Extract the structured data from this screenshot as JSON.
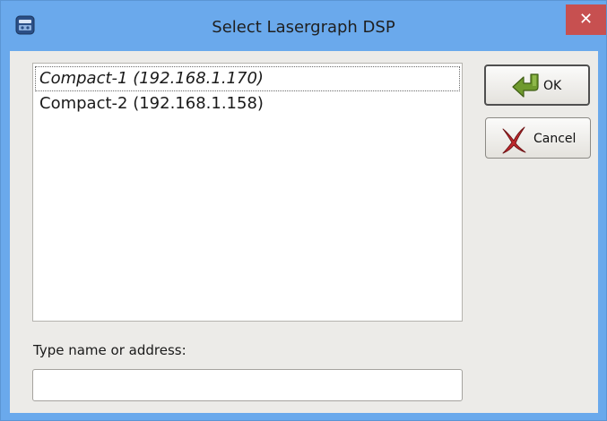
{
  "window": {
    "title": "Select Lasergraph DSP",
    "close_glyph": "✕"
  },
  "devices": [
    {
      "label": "Compact-1 (192.168.1.170)",
      "current": true
    },
    {
      "label": "Compact-2 (192.168.1.158)",
      "current": false
    }
  ],
  "buttons": {
    "ok_label": "OK",
    "cancel_label": "Cancel"
  },
  "address_field": {
    "label": "Type name or address:",
    "value": ""
  },
  "icons": {
    "app": "app-icon",
    "ok": "green-arrow-icon",
    "cancel": "red-x-icon",
    "close": "close-icon"
  },
  "colors": {
    "titlebar": "#6aa9ec",
    "close_button": "#c75050",
    "dialog_background": "#ecebe8",
    "ok_arrow": "#6f9a2e",
    "cancel_x": "#c0282d"
  }
}
